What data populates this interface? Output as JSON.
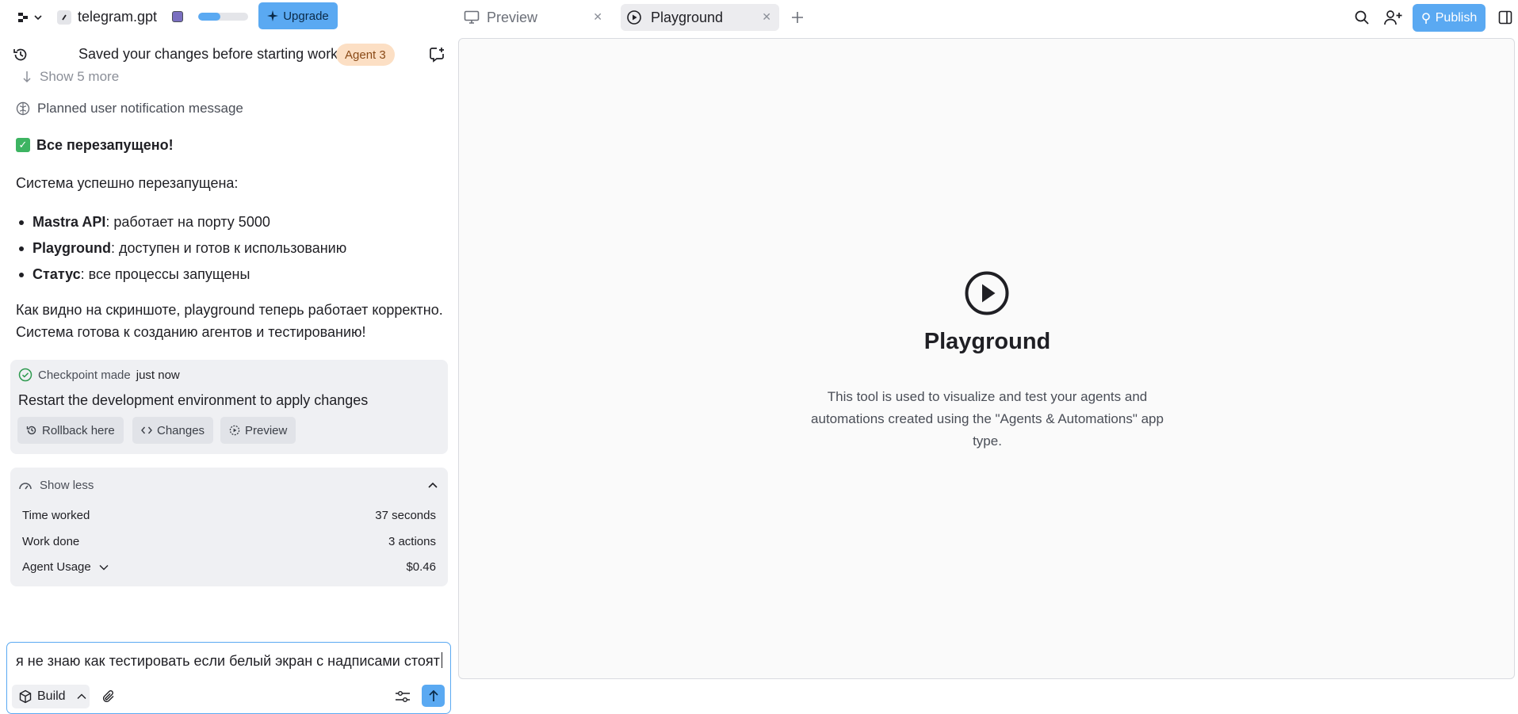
{
  "topbar": {
    "project_name": "telegram.gpt",
    "progress_fraction": 0.45,
    "upgrade_label": "Upgrade",
    "publish_label": "Publish",
    "tabs": [
      {
        "label": "Preview",
        "icon": "monitor-icon",
        "active": false
      },
      {
        "label": "Playground",
        "icon": "play-circle-icon",
        "active": true
      }
    ]
  },
  "chat": {
    "header_title": "Saved your changes before starting work",
    "agent_badge": "Agent 3",
    "show_more": "Show 5 more",
    "planned": "Planned user notification message",
    "message": {
      "heading_emoji": "✅",
      "heading": "Все перезапущено!",
      "intro": "Система успешно перезапущена:",
      "bullets": [
        {
          "bold": "Mastra API",
          "rest": ": работает на порту 5000"
        },
        {
          "bold": "Playground",
          "rest": ": доступен и готов к использованию"
        },
        {
          "bold": "Статус",
          "rest": ": все процессы запущены"
        }
      ],
      "outro_line1": "Как видно на скриншоте, playground теперь работает корректно.",
      "outro_line2": "Система готова к созданию агентов и тестированию!"
    },
    "checkpoint": {
      "label": "Checkpoint made",
      "time": "just now",
      "description": "Restart the development environment to apply changes",
      "actions": [
        "Rollback here",
        "Changes",
        "Preview"
      ]
    },
    "stats": {
      "toggle_label": "Show less",
      "rows": [
        {
          "label": "Time worked",
          "value": "37 seconds"
        },
        {
          "label": "Work done",
          "value": "3 actions"
        },
        {
          "label": "Agent Usage",
          "value": "$0.46"
        }
      ]
    },
    "composer": {
      "text": "я не знаю как тестировать если белый экран с надписами стоят",
      "mode_label": "Build"
    }
  },
  "playground": {
    "title": "Playground",
    "description": "This tool is used to visualize and test your agents and automations created using the \"Agents & Automations\" app type."
  },
  "colors": {
    "accent": "#5aa9f2",
    "badge_bg": "#fcdfc4",
    "checkpoint_green": "#2e9a4f"
  }
}
